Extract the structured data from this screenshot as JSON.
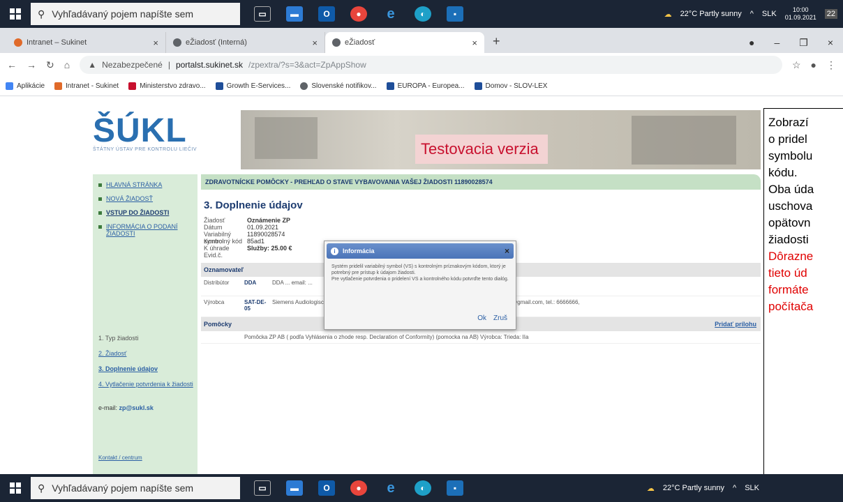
{
  "taskbar": {
    "search_placeholder": "Vyhľadávaný pojem napíšte sem",
    "weather": "22°C Partly sunny",
    "lang": "SLK",
    "time": "10:00",
    "date": "01.09.2021",
    "notif_count": "22"
  },
  "browser": {
    "tabs": [
      {
        "label": "Intranet – Sukinet"
      },
      {
        "label": "eŽiadosť (Interná)"
      },
      {
        "label": "eŽiadosť"
      }
    ],
    "security_label": "Nezabezpečené",
    "domain": "portalst.sukinet.sk",
    "path": "/zpextra/?s=3&act=ZpAppShow",
    "bookmarks": [
      {
        "label": "Aplikácie",
        "color": "#4285f4"
      },
      {
        "label": "Intranet - Sukinet",
        "color": "#e06a2a"
      },
      {
        "label": "Ministerstvo zdravo...",
        "color": "#c8102e"
      },
      {
        "label": "Growth E-Services...",
        "color": "#1f4e99"
      },
      {
        "label": "Slovenské notifikov...",
        "color": "#5f6368"
      },
      {
        "label": "EUROPA - Europea...",
        "color": "#1f4e99"
      },
      {
        "label": "Domov - SLOV-LEX",
        "color": "#1f4e99"
      }
    ]
  },
  "page": {
    "logo_text": "ŠÚKL",
    "logo_sub": "ŠTÁTNY ÚSTAV PRE KONTROLU LIEČIV",
    "banner_text": "Testovacia verzia",
    "sidebar": {
      "nav": [
        {
          "label": "HLAVNÁ STRÁNKA",
          "bold": false
        },
        {
          "label": "NOVÁ ŽIADOSŤ",
          "bold": false
        },
        {
          "label": "VSTUP DO ŽIADOSTI",
          "bold": true
        },
        {
          "label": "INFORMÁCIA O PODANÍ ŽIADOSTI",
          "bold": false
        }
      ],
      "steps": [
        "1. Typ žiadosti",
        "2. Žiadosť",
        "3. Doplnenie údajov",
        "4. Vytlačenie potvrdenia k žiadosti"
      ],
      "email_label": "e-mail:",
      "email": "zp@sukl.sk",
      "feedback": "Kontakt / centrum"
    },
    "header": "ZDRAVOTNÍCKE POMÔCKY - PREHĽAD O STAVE VYBAVOVANIA VAŠEJ ŽIADOSTI 11890028574",
    "section_title": "3. Doplnenie údajov",
    "info": [
      {
        "k": "Žiadosť",
        "v": "Oznámenie ZP"
      },
      {
        "k": "Dátum",
        "v": "01.09.2021"
      },
      {
        "k": "Variabilný symbol",
        "v": "11890028574"
      },
      {
        "k": "Kontrolný kód",
        "v": "85ad1"
      },
      {
        "k": "K úhrade",
        "v": "Služby: 25.00 €"
      },
      {
        "k": "Evid.č.",
        "v": ""
      }
    ],
    "notifier_head": "Oznamovateľ",
    "rows": [
      {
        "lbl": "Distribútor",
        "code": "DDA",
        "text": "DDA ... email: ..."
      },
      {
        "lbl": "Výrobca",
        "code": "SAT-DE-05",
        "text": "Siemens Audiologische Technik GmbH, Gebertstrasse 125, D-91058, Erlangen, DE  email: ████@gmail.com, tel.: 6666666,"
      }
    ],
    "devices_head": "Pomôcky",
    "add_attachment": "Pridať prílohu",
    "device_row": "Pomôcka ZP AB ( podľa Vyhlásenia o zhode resp. Declaration of Conformity) (pomocka na AB) Výrobca: Trieda: IIa"
  },
  "dialog": {
    "title": "Informácia",
    "body1": "Systém pridelil variabilný symbol (VS) s kontrolným príznakovým kódom, ktorý je potrebný pre prístup k údajom žiadosti.",
    "body2": "Pre vytlačenie potvrdenia o pridelení VS a kontrolného kódu potvrďte tento dialóg.",
    "ok": "Ok",
    "cancel": "Zruš"
  },
  "callout": {
    "lines_black": [
      "Zobrazí",
      "o pridel",
      "symbolu",
      "kódu.",
      "Oba úda",
      "uschova",
      "opätovn",
      "žiadosti"
    ],
    "lines_red": [
      "Dôrazne",
      "tieto úd",
      "formáte",
      "počítača"
    ]
  }
}
